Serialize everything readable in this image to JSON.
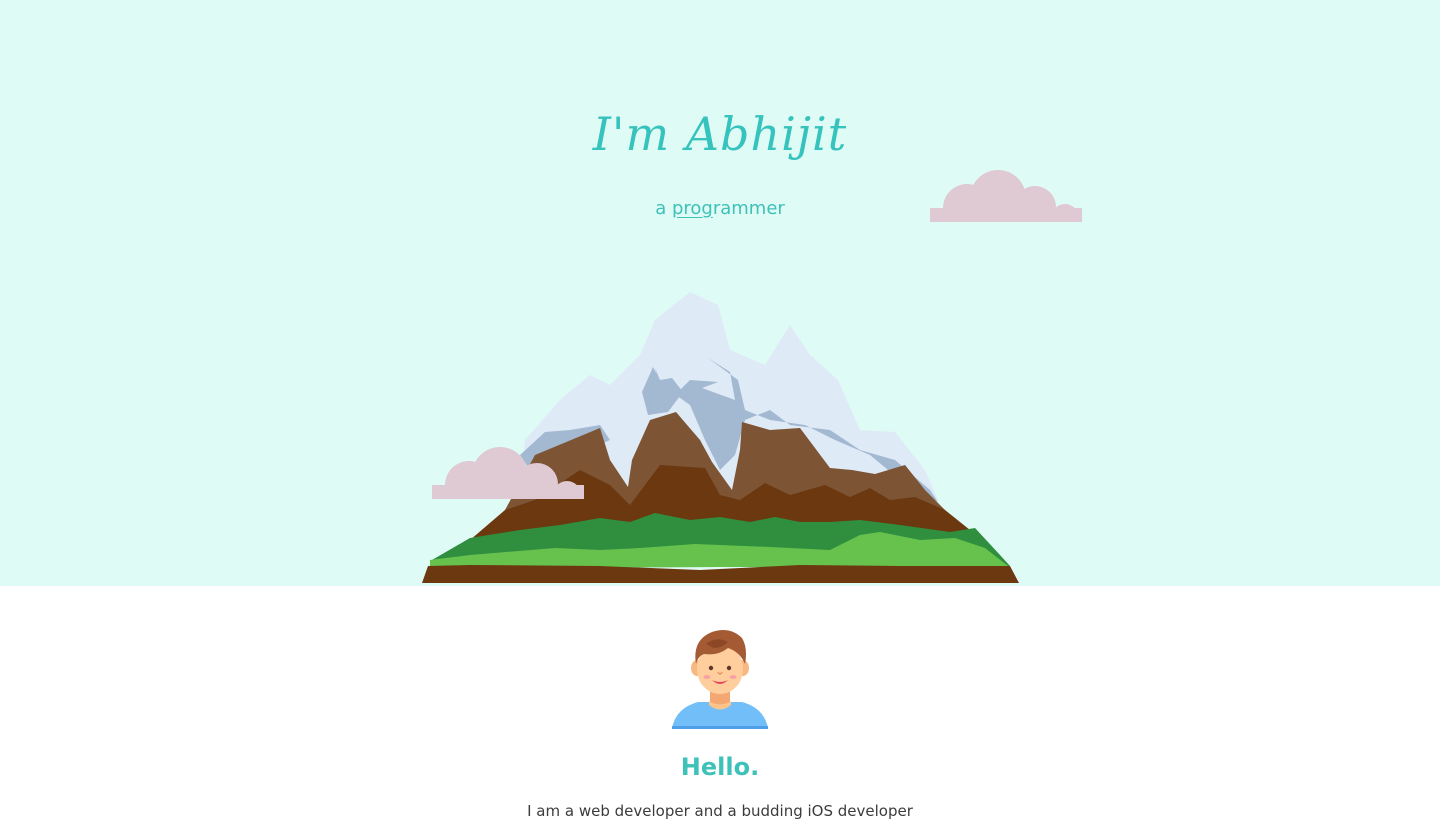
{
  "hero": {
    "title": "I'm Abhijit",
    "tagline_prefix": "a ",
    "tagline_typed": "prog",
    "tagline_rest": "rammer",
    "background_color": "#dffbf5",
    "accent_color": "#36c3bd",
    "illustrations": [
      "mountain-icon",
      "cloud-icon",
      "cloud-icon"
    ]
  },
  "about": {
    "avatar_icon": "person-avatar-icon",
    "heading": "Hello.",
    "intro": "I am a web developer and a budding iOS developer"
  }
}
